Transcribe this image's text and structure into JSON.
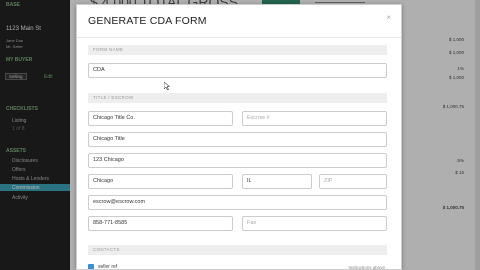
{
  "background": {
    "sidebar": {
      "top_label": "BASE",
      "address": "1123 Main St",
      "sub1": "Jane Doe",
      "sub2": "Mr. Seller",
      "section_buyer": "MY BUYER",
      "status_btn": "Selling",
      "status_edit": "Edit",
      "section_checklists": "CHECKLISTS",
      "listing": "Listing",
      "listing_sub": "1 of 8",
      "section_assets": "ASSETS",
      "items": [
        "Disclosures",
        "Offers",
        "Hosts & Lenders",
        "Commission",
        "Activity"
      ]
    },
    "header_gross": "$ 4,000  TOTAL GROSS",
    "amounts": [
      "$ 1,000",
      "$ 1,000",
      "1%",
      "$ 1,000",
      "$ 1,000.75",
      ".5%",
      "$ 15",
      "$ 1,000.75"
    ]
  },
  "modal": {
    "title": "GENERATE CDA FORM",
    "close_icon": "×",
    "section_form_name": "FORM NAME",
    "form_name_value": "CDA",
    "section_title_escrow": "TITLE / ESCROW",
    "title_company": "Chicago Title Co.",
    "escrow_placeholder": "Escrow #",
    "title_name": "Chicago Title",
    "address": "123 Chicago",
    "city": "Chicago",
    "state": "IL",
    "zip_placeholder": "ZIP",
    "email": "escrow@escrow.com",
    "phone": "858-771-8585",
    "fax_placeholder": "Fax",
    "section_contacts": "CONTACTS",
    "checkbox_label": "seller ref",
    "right_link": "Instructions above"
  }
}
